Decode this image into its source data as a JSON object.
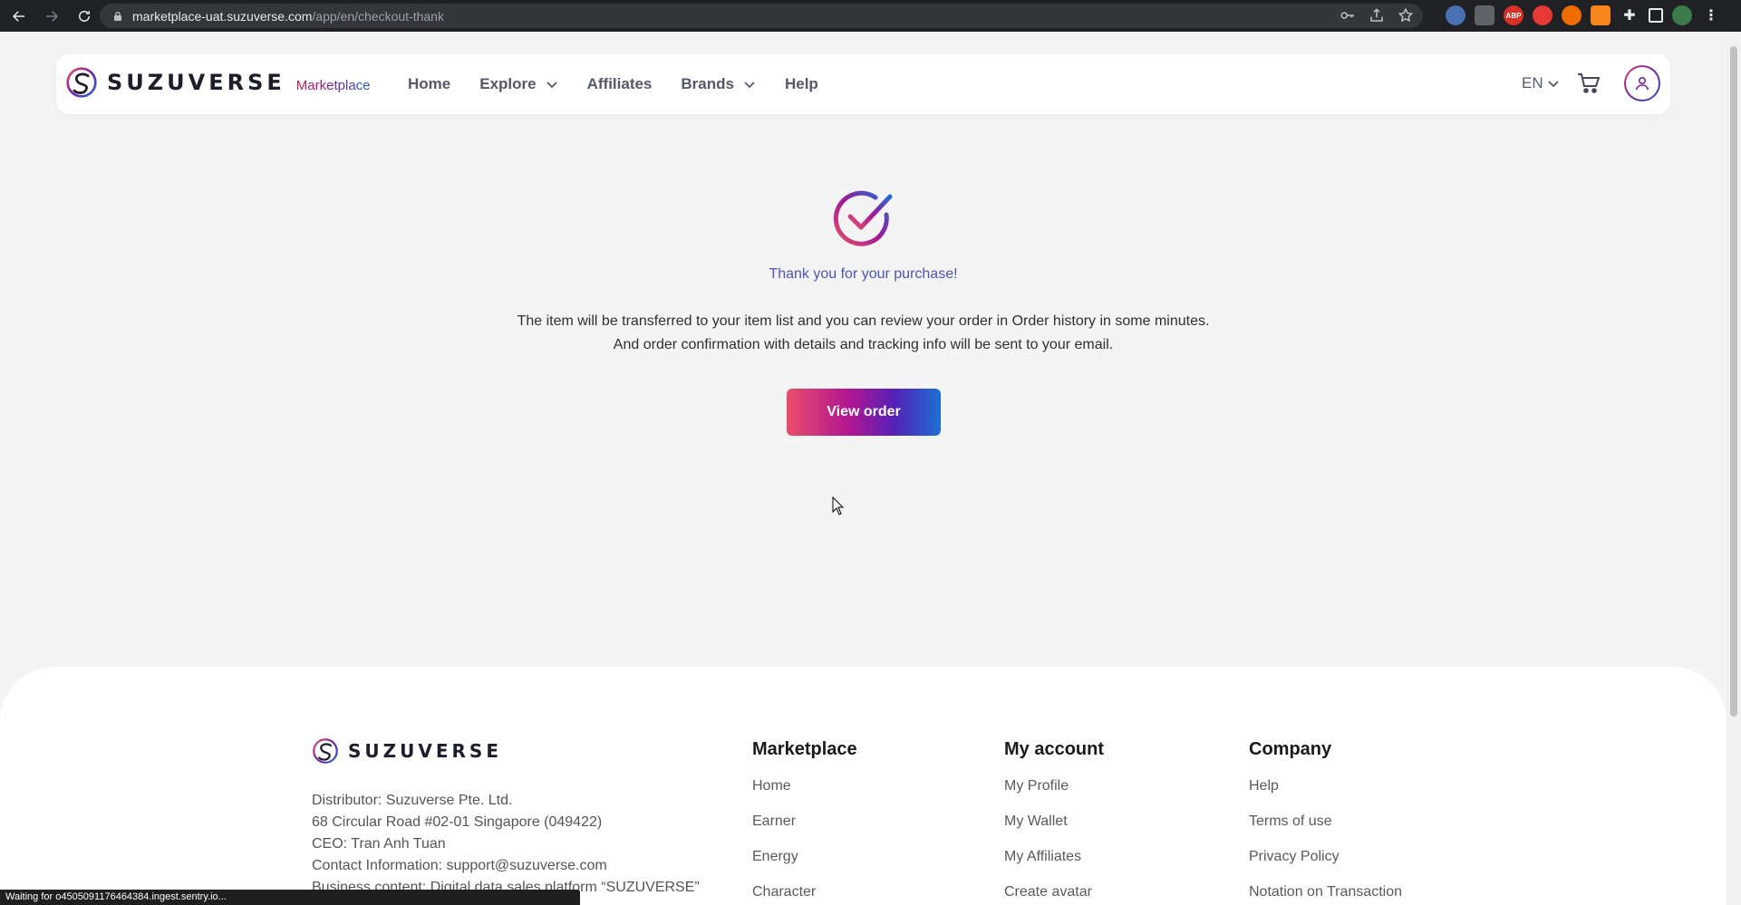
{
  "browser": {
    "url_host": "marketplace-uat.suzuverse.com",
    "url_path": "/app/en/checkout-thank",
    "extension_badge": "ABP"
  },
  "header": {
    "logo_text": "SUZUVERSE",
    "logo_sub": "Marketplace",
    "nav": [
      {
        "label": "Home"
      },
      {
        "label": "Explore"
      },
      {
        "label": "Affiliates"
      },
      {
        "label": "Brands"
      },
      {
        "label": "Help"
      }
    ],
    "language": "EN"
  },
  "main": {
    "thank_you": "Thank you for your purchase!",
    "message_line1": "The item will be transferred to your item list and you can review your order in Order history in some minutes.",
    "message_line2": "And order confirmation with details and tracking info will be sent to your email.",
    "view_order_label": "View order"
  },
  "footer": {
    "logo_text": "SUZUVERSE",
    "company_info": [
      "Distributor: Suzuverse Pte. Ltd.",
      "68 Circular Road #02-01 Singapore (049422)",
      "CEO: Tran Anh Tuan",
      "Contact Information: support@suzuverse.com",
      "Business content: Digital data sales platform “SUZUVERSE”"
    ],
    "columns": [
      {
        "title": "Marketplace",
        "links": [
          "Home",
          "Earner",
          "Energy",
          "Character"
        ]
      },
      {
        "title": "My account",
        "links": [
          "My Profile",
          "My Wallet",
          "My Affiliates",
          "Create avatar"
        ]
      },
      {
        "title": "Company",
        "links": [
          "Help",
          "Terms of use",
          "Privacy Policy",
          "Notation on Transaction"
        ]
      }
    ]
  },
  "status_bar": "Waiting for o4505091176464384.ingest.sentry.io...",
  "colors": {
    "brand_pink": "#e94f6a",
    "brand_purple": "#7b1fa2",
    "brand_blue": "#1c6fd2",
    "thank_text": "#4d54b8"
  }
}
